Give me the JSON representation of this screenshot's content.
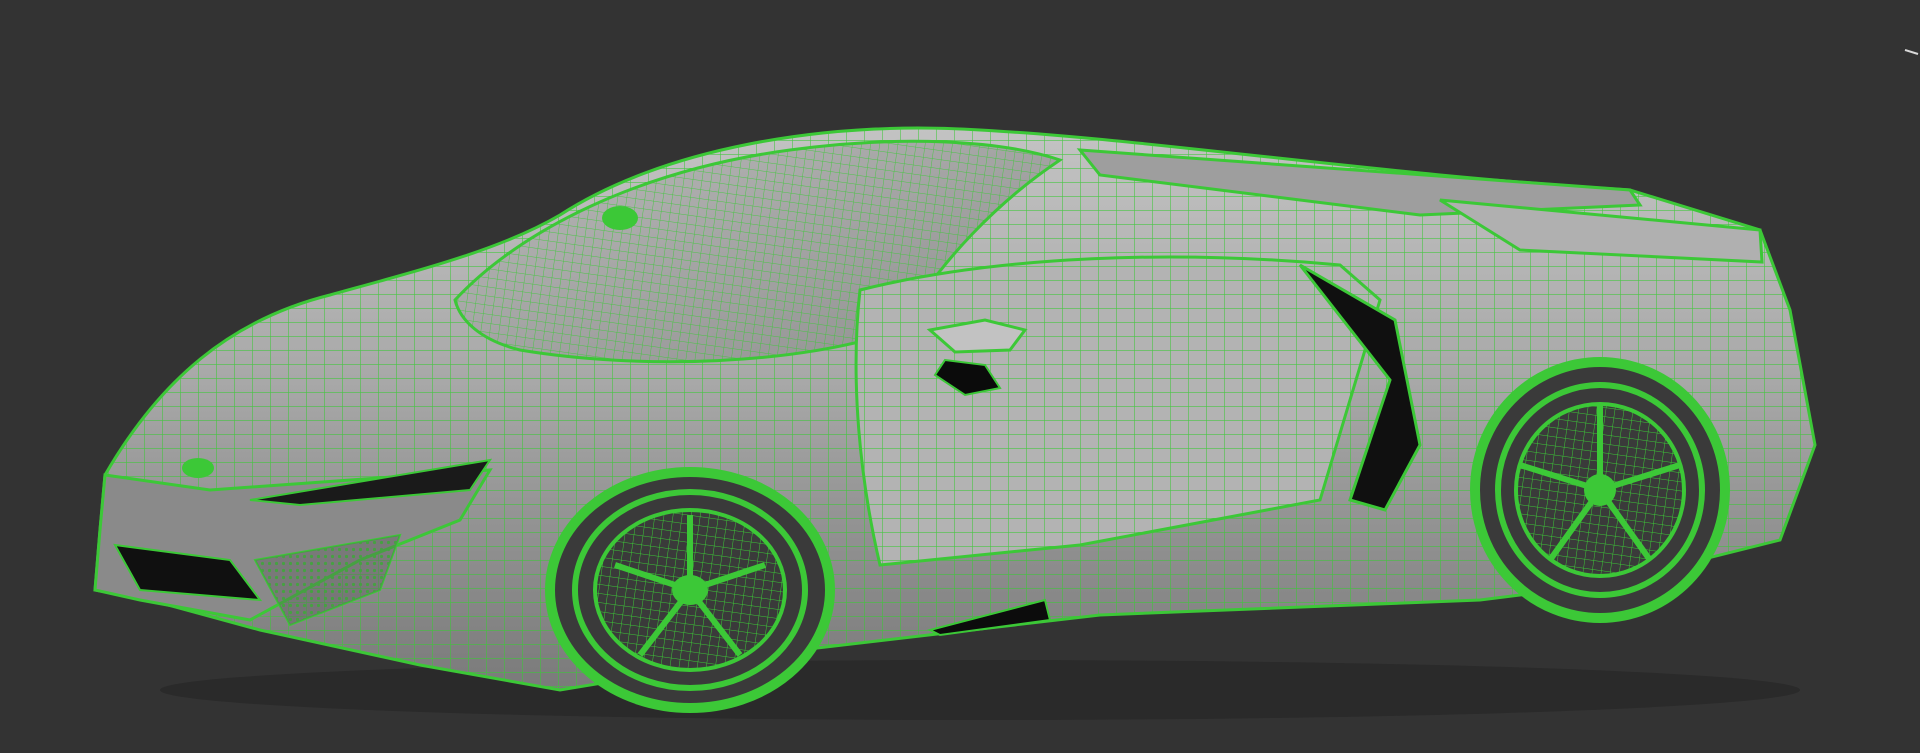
{
  "viewport": {
    "background": "#333333",
    "shading": "smooth-with-wireframe-edges",
    "wire_color": "#3cc837",
    "surface_color": "#a6a6a6",
    "shadow_color": "#595959",
    "model": "supercar-mesh",
    "overlay_text": ""
  }
}
